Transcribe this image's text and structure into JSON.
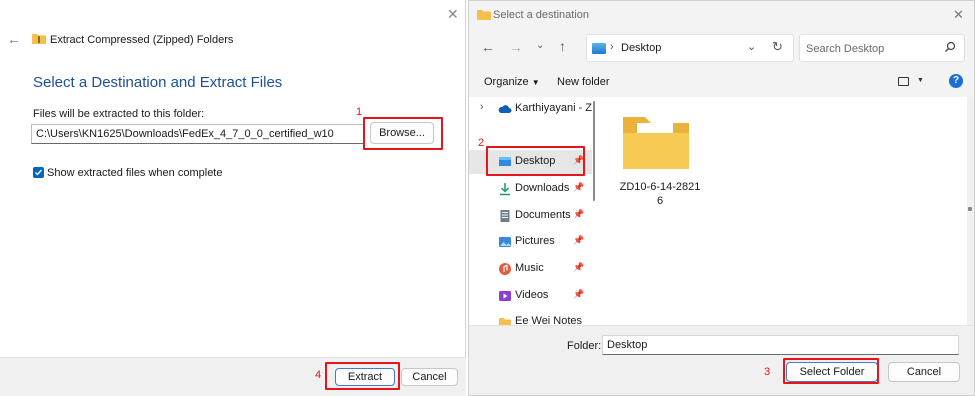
{
  "wizard": {
    "title": "Extract Compressed (Zipped) Folders",
    "heading": "Select a Destination and Extract Files",
    "dest_label": "Files will be extracted to this folder:",
    "dest_value": "C:\\Users\\KN1625\\Downloads\\FedEx_4_7_0_0_certified_w10",
    "browse_label": "Browse...",
    "show_files_label": "Show extracted files when complete",
    "show_files_checked": true,
    "extract_label": "Extract",
    "cancel_label": "Cancel"
  },
  "dialog": {
    "title": "Select a destination",
    "breadcrumb": "Desktop",
    "search_placeholder": "Search Desktop",
    "organize_label": "Organize",
    "new_folder_label": "New folder",
    "nav_items": [
      {
        "label": "Karthiyayani - Z",
        "icon": "cloud-icon",
        "pinned": false
      },
      {
        "label": "Desktop",
        "icon": "desktop-icon",
        "pinned": true
      },
      {
        "label": "Downloads",
        "icon": "download-icon",
        "pinned": true
      },
      {
        "label": "Documents",
        "icon": "documents-icon",
        "pinned": true
      },
      {
        "label": "Pictures",
        "icon": "pictures-icon",
        "pinned": true
      },
      {
        "label": "Music",
        "icon": "music-icon",
        "pinned": true
      },
      {
        "label": "Videos",
        "icon": "videos-icon",
        "pinned": true
      },
      {
        "label": "Ee Wei Notes",
        "icon": "folder-icon",
        "pinned": false
      }
    ],
    "folder_item": {
      "name_line1": "ZD10-6-14-2821",
      "name_line2": "6"
    },
    "folder_label": "Folder:",
    "folder_value": "Desktop",
    "select_label": "Select Folder",
    "cancel_label": "Cancel"
  },
  "annotations": {
    "step1": "1",
    "step2": "2",
    "step3": "3",
    "step4": "4",
    "color": "#e8141c"
  },
  "colors": {
    "heading_blue": "#1b4f9c",
    "accent": "#0067c0"
  }
}
